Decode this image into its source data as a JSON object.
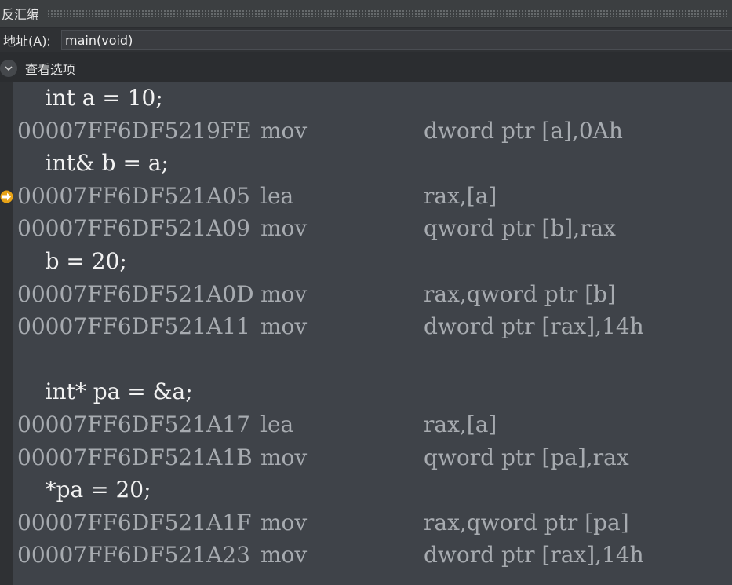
{
  "window": {
    "title": "反汇编"
  },
  "address_bar": {
    "label": "地址(A):",
    "value": "main(void)"
  },
  "view_options": {
    "label": "查看选项"
  },
  "lines": [
    {
      "kind": "src",
      "text": "    int a = 10;"
    },
    {
      "kind": "asm",
      "addr": "00007FF6DF5219FE",
      "op": "mov",
      "args": "dword ptr [a],0Ah"
    },
    {
      "kind": "src",
      "text": "    int& b = a;"
    },
    {
      "kind": "asm",
      "addr": "00007FF6DF521A05",
      "op": "lea",
      "args": "rax,[a]",
      "current": true
    },
    {
      "kind": "asm",
      "addr": "00007FF6DF521A09",
      "op": "mov",
      "args": "qword ptr [b],rax"
    },
    {
      "kind": "src",
      "text": "    b = 20;"
    },
    {
      "kind": "asm",
      "addr": "00007FF6DF521A0D",
      "op": "mov",
      "args": "rax,qword ptr [b]"
    },
    {
      "kind": "asm",
      "addr": "00007FF6DF521A11",
      "op": "mov",
      "args": "dword ptr [rax],14h"
    },
    {
      "kind": "src",
      "text": ""
    },
    {
      "kind": "src",
      "text": "    int* pa = &a;"
    },
    {
      "kind": "asm",
      "addr": "00007FF6DF521A17",
      "op": "lea",
      "args": "rax,[a]"
    },
    {
      "kind": "asm",
      "addr": "00007FF6DF521A1B",
      "op": "mov",
      "args": "qword ptr [pa],rax"
    },
    {
      "kind": "src",
      "text": "    *pa = 20;"
    },
    {
      "kind": "asm",
      "addr": "00007FF6DF521A1F",
      "op": "mov",
      "args": "rax,qword ptr [pa]"
    },
    {
      "kind": "asm",
      "addr": "00007FF6DF521A23",
      "op": "mov",
      "args": "dword ptr [rax],14h"
    }
  ],
  "icons": {
    "expand": "chevron-down-icon",
    "current_instruction": "current-instruction-arrow-icon"
  },
  "colors": {
    "source_text": "#f2f2f2",
    "asm_text": "#a7abb0",
    "arrow": "#e8a317"
  }
}
